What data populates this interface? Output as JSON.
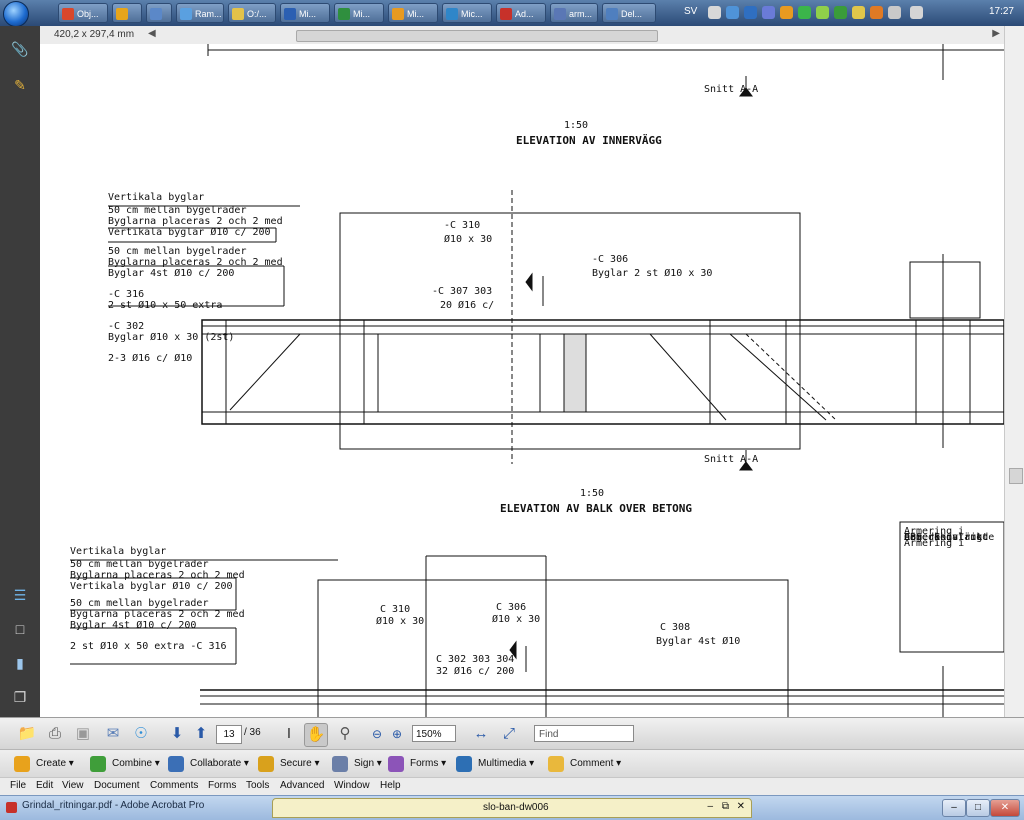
{
  "taskbar": {
    "tasks": [
      {
        "label": "Obj...",
        "color": "#d9472b"
      },
      {
        "label": "",
        "color": "#e7a51a"
      },
      {
        "label": "",
        "color": "#5b88c8"
      },
      {
        "label": "Ram...",
        "color": "#5aa0e0"
      },
      {
        "label": "O:/...",
        "color": "#e3c24a"
      },
      {
        "label": "Mi...",
        "color": "#2b5fb2"
      },
      {
        "label": "Mi...",
        "color": "#2f8f3e"
      },
      {
        "label": "Mi...",
        "color": "#e79a21"
      },
      {
        "label": "Mic...",
        "color": "#2f86c9"
      },
      {
        "label": "Ad...",
        "color": "#c7312a"
      },
      {
        "label": "arm...",
        "color": "#5a77b5"
      },
      {
        "label": "Del...",
        "color": "#4f7fbf"
      }
    ],
    "language": "SV",
    "clock": "17:27"
  },
  "ruler": {
    "measure": "420,2 x 297,4 mm"
  },
  "drawing": {
    "elevation_a_title": "ELEVATION AV INNERVÄGG",
    "elevation_a_scale": "1:50",
    "elevation_b_title": "ELEVATION AV BALK OVER BETONG",
    "elevation_b_scale": "1:50",
    "section_a": "Snitt A-A",
    "section_b": "Snitt A-A",
    "notes_a": [
      "Vertikala byglar",
      "50 cm mellan bygelrader",
      "Byglarna placeras 2 och 2 med",
      "Vertikala byglar Ø10 c/ 200",
      "50 cm mellan bygelrader",
      "Byglarna placeras 2 och 2 med",
      "Byglar 4st Ø10 c/ 200",
      "-C 316",
      "2 st Ø10 x 50 extra",
      "-C 302",
      "Byglar Ø10 x 30 (2st)",
      "2-3 Ø16 c/ Ø10"
    ],
    "labels_a": [
      "-C 310",
      "Ø10 x 30",
      "-C 306",
      "Byglar 2 st Ø10 x 30",
      "-C 307 303",
      "20 Ø16 c/"
    ],
    "notes_b": [
      "Vertikala byglar",
      "50 cm mellan bygelrader",
      "Byglarna placeras 2 och 2 med",
      "Vertikala byglar Ø10 c/ 200",
      "50 cm mellan bygelrader",
      "Byglarna placeras 2 och 2 med",
      "Byglar 4st Ø10 c/ 200",
      "2 st Ø10 x 50 extra -C 316"
    ],
    "labels_b": [
      "C 310",
      "Ø10 x 30",
      "C 306",
      "Ø10 x 30",
      "C 308",
      "Byglar 4st Ø10",
      "C 302 303 304",
      "32 Ø16 c/ 200"
    ],
    "legend_b": [
      "Armering i",
      "Lagerkonstrukt",
      "Armering i",
      "Armering i",
      "För denna rit",
      "OBS. Skivlängde"
    ]
  },
  "toolbar": {
    "page_current": "13",
    "page_total": "/ 36",
    "zoom": "150%",
    "find_placeholder": "Find"
  },
  "tasks": [
    {
      "label": "Create",
      "color": "#e8a21c"
    },
    {
      "label": "Combine",
      "color": "#3f9e3a"
    },
    {
      "label": "Collaborate",
      "color": "#3b6fb6"
    },
    {
      "label": "Secure",
      "color": "#d9a11c"
    },
    {
      "label": "Sign",
      "color": "#6b7fa8"
    },
    {
      "label": "Forms",
      "color": "#8c54b8"
    },
    {
      "label": "Multimedia",
      "color": "#2d6fb4"
    },
    {
      "label": "Comment",
      "color": "#e9b83c"
    }
  ],
  "menu": [
    "File",
    "Edit",
    "View",
    "Document",
    "Comments",
    "Forms",
    "Tools",
    "Advanced",
    "Window",
    "Help"
  ],
  "window": {
    "title": "Grindal_ritningar.pdf - Adobe Acrobat Pro",
    "doc_tab": "slo-ban-dw006"
  }
}
